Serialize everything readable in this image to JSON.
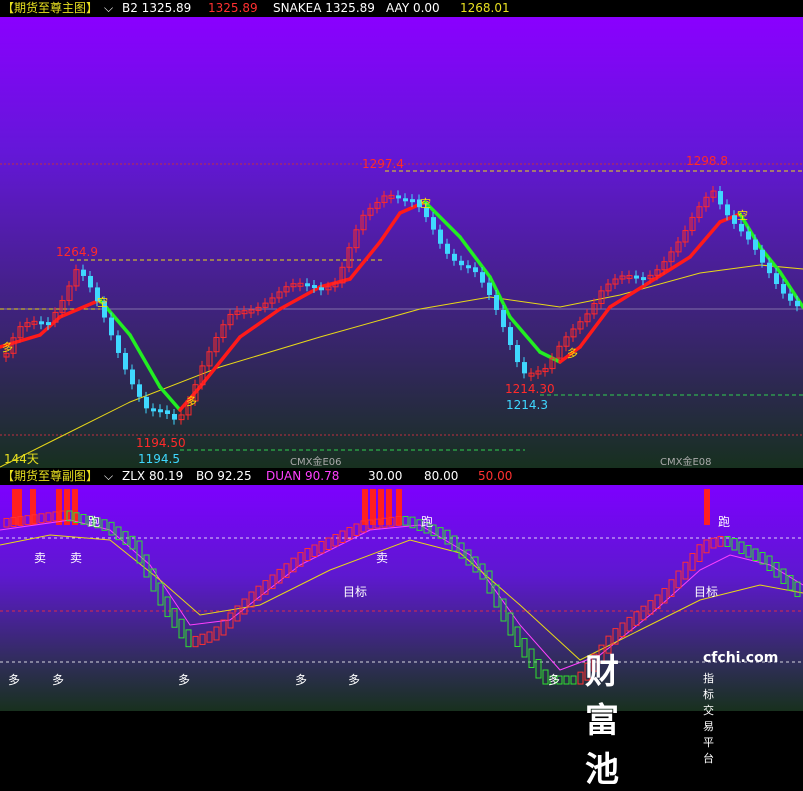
{
  "main_header": {
    "title": "【期货至尊主图】",
    "b2": "B2 1325.89",
    "b2_value_red": "1325.89",
    "snakea": "SNAKEA 1325.89",
    "aay": "AAY 0.00",
    "last": "1268.01"
  },
  "main_chart": {
    "labels": {
      "high1": "1264.9",
      "high2": "1297.4",
      "high3": "1298.8",
      "low1_red": "1194.50",
      "low1_cyan": "1194.5",
      "low2_red": "1214.30",
      "low2_cyan": "1214.3",
      "days": "144天",
      "contract1": "CMX金E06",
      "contract2": "CMX金E08",
      "kong": "空",
      "duo": "多"
    }
  },
  "sub_header": {
    "title": "【期货至尊副图】",
    "zlx": "ZLX 80.19",
    "bo": "BO 92.25",
    "duan": "DUAN 90.78",
    "lvl30": "30.00",
    "lvl80": "80.00",
    "lvl50": "50.00"
  },
  "sub_chart": {
    "labels": {
      "pao": "跑",
      "mai": "卖",
      "duo": "多",
      "mubiao": "目标"
    }
  },
  "watermark": {
    "brand": "财富池",
    "site": "cfchi.com",
    "tagline": "指标交易平台"
  },
  "colors": {
    "up": "#ff2a2a",
    "down": "#3fd8ff",
    "ma_up": "#ff1a1a",
    "ma_down": "#22ee22",
    "long_ma": "#e8d818",
    "level_line": "#e8d818"
  }
}
